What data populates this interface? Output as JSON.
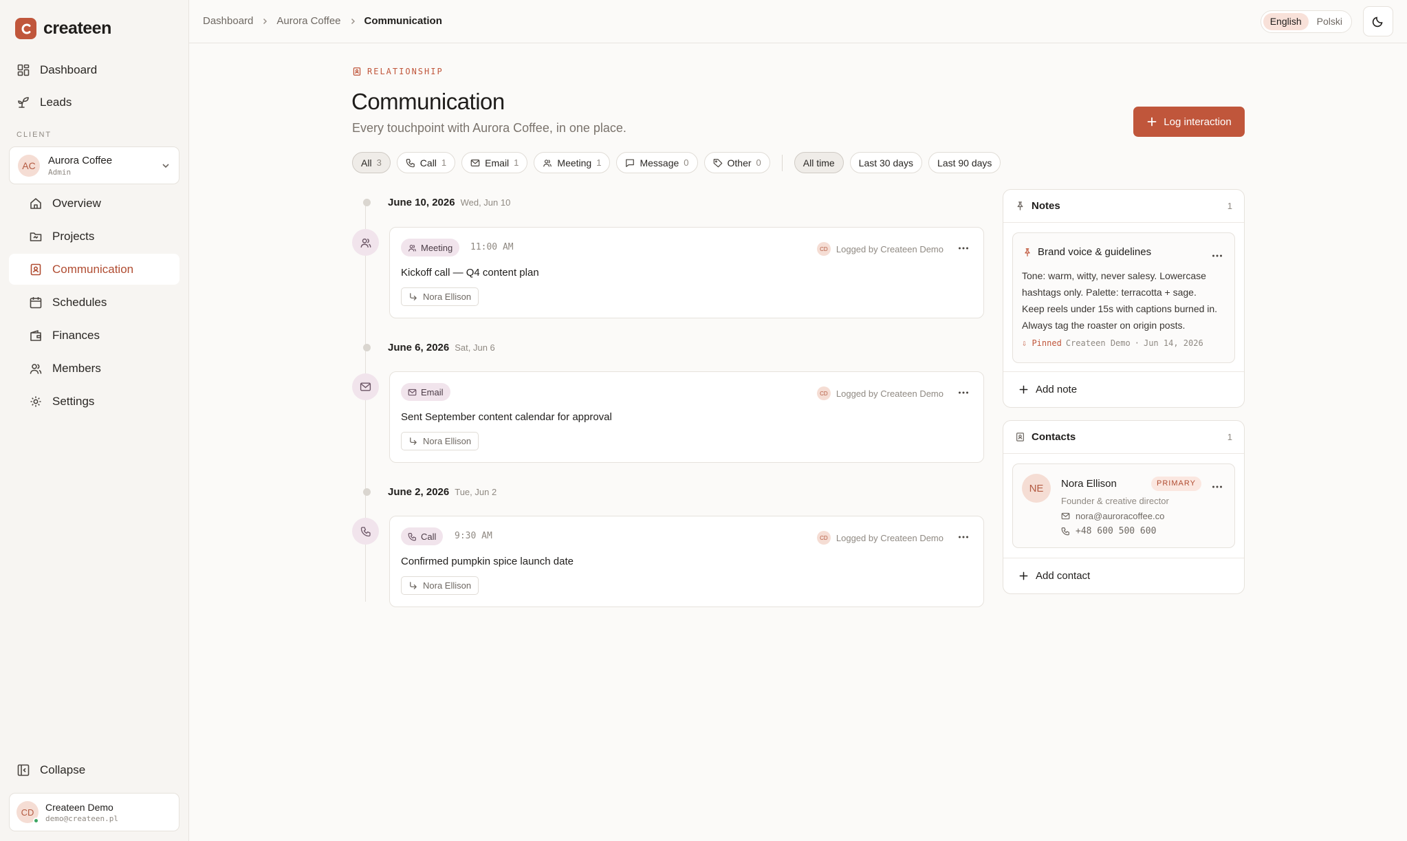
{
  "app": {
    "name": "createen"
  },
  "sidebar": {
    "nav": [
      {
        "label": "Dashboard",
        "icon": "grid-icon"
      },
      {
        "label": "Leads",
        "icon": "sprout-icon"
      }
    ],
    "section_label": "CLIENT",
    "client": {
      "initials": "AC",
      "name": "Aurora Coffee",
      "role": "Admin"
    },
    "client_nav": [
      {
        "label": "Overview",
        "icon": "home-icon"
      },
      {
        "label": "Projects",
        "icon": "folder-icon"
      },
      {
        "label": "Communication",
        "icon": "contact-book-icon",
        "active": true
      },
      {
        "label": "Schedules",
        "icon": "calendar-icon"
      },
      {
        "label": "Finances",
        "icon": "wallet-icon"
      },
      {
        "label": "Members",
        "icon": "users-icon"
      },
      {
        "label": "Settings",
        "icon": "gear-icon"
      }
    ],
    "collapse_label": "Collapse",
    "user": {
      "initials": "CD",
      "name": "Createen Demo",
      "email": "demo@createen.pl"
    }
  },
  "topbar": {
    "breadcrumb": [
      "Dashboard",
      "Aurora Coffee",
      "Communication"
    ],
    "languages": [
      "English",
      "Polski"
    ],
    "active_language": "English"
  },
  "header": {
    "eyebrow": "RELATIONSHIP",
    "title": "Communication",
    "subtitle": "Every touchpoint with Aurora Coffee, in one place.",
    "log_button": "Log interaction"
  },
  "filters": {
    "types": [
      {
        "label": "All",
        "count": "3",
        "active": true
      },
      {
        "label": "Call",
        "count": "1"
      },
      {
        "label": "Email",
        "count": "1"
      },
      {
        "label": "Meeting",
        "count": "1"
      },
      {
        "label": "Message",
        "count": "0"
      },
      {
        "label": "Other",
        "count": "0"
      }
    ],
    "ranges": [
      {
        "label": "All time",
        "active": true
      },
      {
        "label": "Last 30 days"
      },
      {
        "label": "Last 90 days"
      }
    ]
  },
  "timeline": [
    {
      "date": "June 10, 2026",
      "weekday": "Wed, Jun 10",
      "type": "Meeting",
      "time": "11:00 AM",
      "logged_by": "Logged by Createen Demo",
      "logger_initials": "CD",
      "title": "Kickoff call — Q4 content plan",
      "contact": "Nora Ellison"
    },
    {
      "date": "June 6, 2026",
      "weekday": "Sat, Jun 6",
      "type": "Email",
      "time": "",
      "logged_by": "Logged by Createen Demo",
      "logger_initials": "CD",
      "title": "Sent September content calendar for approval",
      "contact": "Nora Ellison"
    },
    {
      "date": "June 2, 2026",
      "weekday": "Tue, Jun 2",
      "type": "Call",
      "time": "9:30 AM",
      "logged_by": "Logged by Createen Demo",
      "logger_initials": "CD",
      "title": "Confirmed pumpkin spice launch date",
      "contact": "Nora Ellison"
    }
  ],
  "notes": {
    "title": "Notes",
    "count": "1",
    "items": [
      {
        "title": "Brand voice & guidelines",
        "body": "Tone: warm, witty, never salesy. Lowercase hashtags only. Palette: terracotta + sage. Keep reels under 15s with captions burned in. Always tag the roaster on origin posts.",
        "pinned": "Pinned",
        "author": "Createen Demo",
        "date": "Jun 14, 2026"
      }
    ],
    "add_label": "Add note"
  },
  "contacts": {
    "title": "Contacts",
    "count": "1",
    "items": [
      {
        "initials": "NE",
        "name": "Nora Ellison",
        "badge": "PRIMARY",
        "role": "Founder & creative director",
        "email": "nora@auroracoffee.co",
        "phone": "+48 600 500 600"
      }
    ],
    "add_label": "Add contact"
  },
  "colors": {
    "accent": "#c0563b",
    "type_tint": "#f1e4ec",
    "page_bg": "#fbfaf8"
  }
}
